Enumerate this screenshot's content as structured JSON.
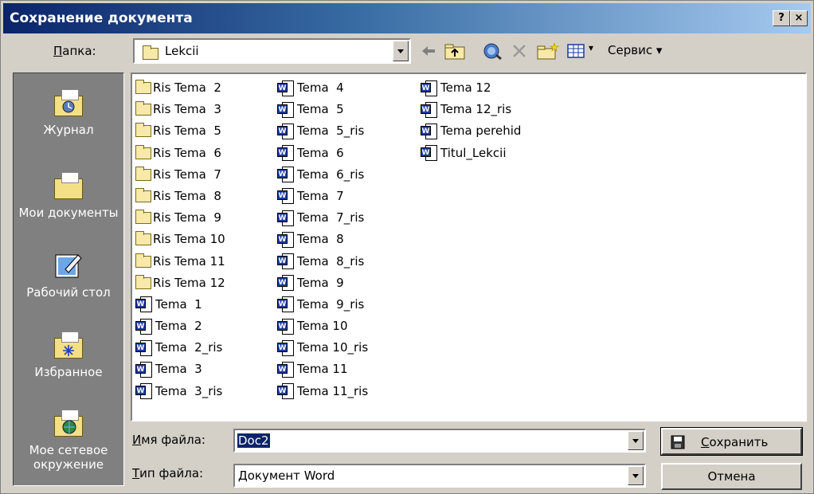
{
  "titlebar": {
    "title": "Сохранение документа",
    "help_label": "?",
    "close_label": "×"
  },
  "folder_row": {
    "label_u": "П",
    "label_rest": "апка:",
    "current": "Lekcii",
    "service_label": "Сервис ▾"
  },
  "places": [
    {
      "label": "Журнал"
    },
    {
      "label": "Мои документы"
    },
    {
      "label": "Рабочий стол"
    },
    {
      "label": "Избранное"
    },
    {
      "label": "Мое сетевое окружение"
    }
  ],
  "files": {
    "col1": [
      {
        "name": "Ris Tema  2",
        "type": "folder"
      },
      {
        "name": "Ris Tema  3",
        "type": "folder"
      },
      {
        "name": "Ris Tema  5",
        "type": "folder"
      },
      {
        "name": "Ris Tema  6",
        "type": "folder"
      },
      {
        "name": "Ris Tema  7",
        "type": "folder"
      },
      {
        "name": "Ris Tema  8",
        "type": "folder"
      },
      {
        "name": "Ris Tema  9",
        "type": "folder"
      },
      {
        "name": "Ris Tema 10",
        "type": "folder"
      },
      {
        "name": "Ris Tema 11",
        "type": "folder"
      },
      {
        "name": "Ris Tema 12",
        "type": "folder"
      },
      {
        "name": "Tema  1",
        "type": "doc"
      },
      {
        "name": "Tema  2",
        "type": "doc"
      },
      {
        "name": "Tema  2_ris",
        "type": "doc"
      },
      {
        "name": "Tema  3",
        "type": "doc"
      },
      {
        "name": "Tema  3_ris",
        "type": "doc"
      }
    ],
    "col2": [
      {
        "name": "Tema  4",
        "type": "doc"
      },
      {
        "name": "Tema  5",
        "type": "doc"
      },
      {
        "name": "Tema  5_ris",
        "type": "doc"
      },
      {
        "name": "Tema  6",
        "type": "doc"
      },
      {
        "name": "Tema  6_ris",
        "type": "doc"
      },
      {
        "name": "Tema  7",
        "type": "doc"
      },
      {
        "name": "Tema  7_ris",
        "type": "doc"
      },
      {
        "name": "Tema  8",
        "type": "doc"
      },
      {
        "name": "Tema  8_ris",
        "type": "doc"
      },
      {
        "name": "Tema  9",
        "type": "doc"
      },
      {
        "name": "Tema  9_ris",
        "type": "doc"
      },
      {
        "name": "Tema 10",
        "type": "doc"
      },
      {
        "name": "Tema 10_ris",
        "type": "doc"
      },
      {
        "name": "Tema 11",
        "type": "doc"
      },
      {
        "name": "Tema 11_ris",
        "type": "doc"
      }
    ],
    "col3": [
      {
        "name": "Tema 12",
        "type": "doc"
      },
      {
        "name": "Tema 12_ris",
        "type": "doc"
      },
      {
        "name": "Tema perehid",
        "type": "doc"
      },
      {
        "name": "Titul_Lekcii",
        "type": "doc"
      }
    ]
  },
  "filename": {
    "label_u": "И",
    "label_rest": "мя файла:",
    "value": "Doc2"
  },
  "filetype": {
    "label_u": "Т",
    "label_rest": "ип файла:",
    "value": "Документ Word"
  },
  "buttons": {
    "save_u": "С",
    "save_rest": "охранить",
    "cancel": "Отмена"
  },
  "colors": {
    "title_start": "#0a246a",
    "title_end": "#a6caf0",
    "face": "#d4d0c8",
    "places_bg": "#808080"
  }
}
